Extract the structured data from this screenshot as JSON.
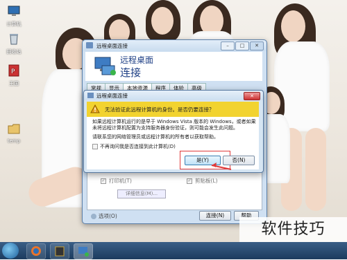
{
  "desktop": {
    "icons": [
      {
        "label": "计算机",
        "icon": "computer-icon"
      },
      {
        "label": "回收站",
        "icon": "recycle-bin-icon"
      },
      {
        "label": "王国",
        "icon": "app-icon"
      },
      {
        "label": "temp",
        "icon": "folder-icon"
      }
    ]
  },
  "main_dialog": {
    "title": "远程桌面连接",
    "header_line1": "远程桌面",
    "header_line2": "连接",
    "tabs": [
      "常规",
      "显示",
      "本地资源",
      "程序",
      "体验",
      "高级"
    ],
    "active_tab": "本地资源",
    "printer_label": "打印机(T)",
    "clipboard_label": "剪贴板(L)",
    "details_label": "详细信息(M)...",
    "options_label": "选项(O)",
    "connect_label": "连接(N)",
    "help_label": "帮助"
  },
  "warning_dialog": {
    "title": "远程桌面连接",
    "banner": "无法验证此远程计算机的身份。是否仍要连接？",
    "paragraph1": "如果远程计算机运行的是早于 Windows Vista 版本的 Windows，或者如果未将远程计算机配置为支持服务器身份验证，则可能会发生此问题。",
    "paragraph2": "请联系您的网络管理员或远程计算机的所有者以获取帮助。",
    "dont_ask": "不再询问我是否连接到此计算机(D)",
    "yes_label": "是(Y)",
    "no_label": "否(N)"
  },
  "watermark": "软件技巧",
  "colors": {
    "warning_banner": "#f2d330",
    "highlight_box": "#e03a3a",
    "header_text": "#1e3f85"
  }
}
